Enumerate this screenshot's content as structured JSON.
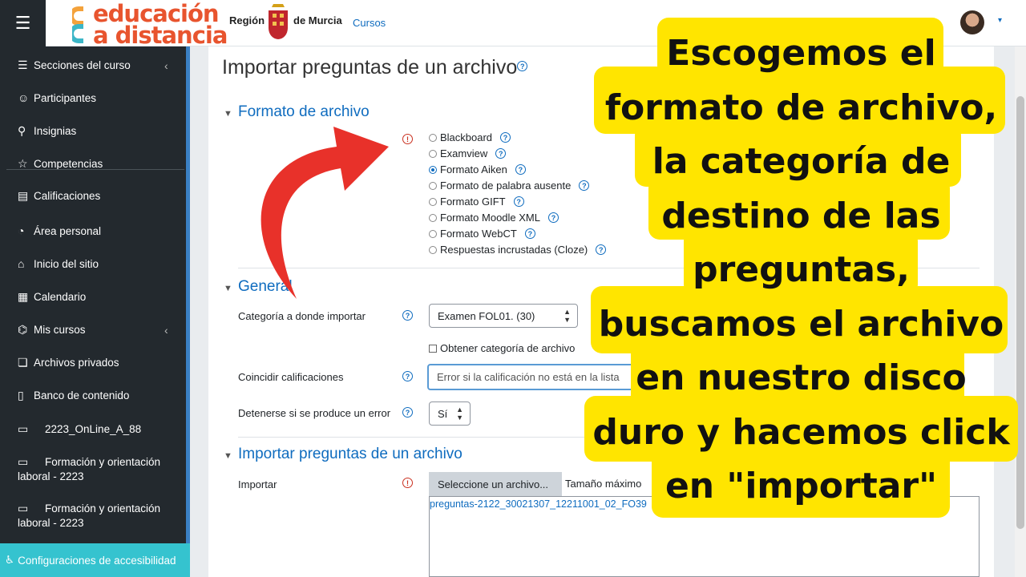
{
  "header": {
    "logo_line1": "educación",
    "logo_line2": "a distancia",
    "region": "Región",
    "murcia": "de Murcia",
    "cursos": "Cursos"
  },
  "sidebar": {
    "items": [
      {
        "label": "Secciones del curso",
        "icon": "list-icon"
      },
      {
        "label": "Participantes",
        "icon": "users-icon"
      },
      {
        "label": "Insignias",
        "icon": "badge-icon"
      },
      {
        "label": "Competencias",
        "icon": "star-icon"
      },
      {
        "label": "Calificaciones",
        "icon": "grades-icon"
      },
      {
        "label": "Área personal",
        "icon": "dashboard-icon"
      },
      {
        "label": "Inicio del sitio",
        "icon": "home-icon"
      },
      {
        "label": "Calendario",
        "icon": "calendar-icon"
      },
      {
        "label": "Mis cursos",
        "icon": "graduation-cap-icon"
      },
      {
        "label": "Archivos privados",
        "icon": "files-icon"
      },
      {
        "label": "Banco de contenido",
        "icon": "clipboard-icon"
      }
    ],
    "courses": [
      "2223_OnLine_A_88",
      "Formación y orientación laboral - 2223",
      "Formación y orientación laboral - 2223"
    ],
    "accessibility": "Configuraciones de accesibilidad"
  },
  "main": {
    "title": "Importar preguntas de un archivo",
    "section_format": "Formato de archivo",
    "formats": [
      {
        "label": "Blackboard",
        "checked": false
      },
      {
        "label": "Examview",
        "checked": false
      },
      {
        "label": "Formato Aiken",
        "checked": true
      },
      {
        "label": "Formato de palabra ausente",
        "checked": false
      },
      {
        "label": "Formato GIFT",
        "checked": false
      },
      {
        "label": "Formato Moodle XML",
        "checked": false
      },
      {
        "label": "Formato WebCT",
        "checked": false
      },
      {
        "label": "Respuestas incrustadas (Cloze)",
        "checked": false
      }
    ],
    "section_general": "General",
    "category_label": "Categoría a donde importar",
    "category_value": "Examen FOL01. (30)",
    "get_category_label": "Obtener categoría de archivo",
    "match_grades_label": "Coincidir calificaciones",
    "match_grades_value": "Error si la calificación no está en la lista",
    "stop_on_error_label": "Detenerse si se produce un error",
    "stop_on_error_value": "Sí",
    "section_import": "Importar preguntas de un archivo",
    "import_label": "Importar",
    "choose_file_button": "Seleccione un archivo...",
    "max_size_text": "Tamaño máximo",
    "file_name": "preguntas-2122_30021307_12211001_02_FO39"
  },
  "overlay": {
    "lines": [
      "Escogemos el",
      "formato de archivo,",
      "la categoría de",
      "destino de las",
      "preguntas,",
      "buscamos el archivo",
      "en nuestro disco",
      "duro y hacemos click",
      "en \"importar\""
    ]
  },
  "colors": {
    "sidebar_bg": "#23292e",
    "link_blue": "#0f6cbf",
    "overlay_yellow": "#ffe500",
    "arrow_red": "#e8312a",
    "access_bar": "#35c3cf"
  }
}
